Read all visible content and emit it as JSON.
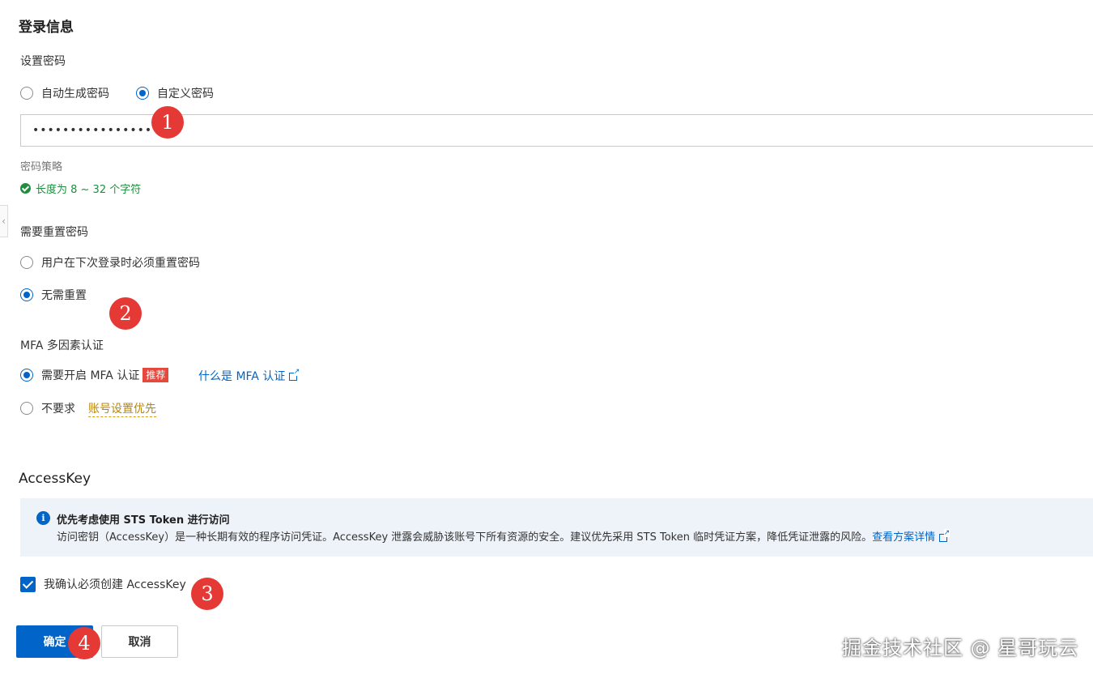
{
  "login_info": {
    "title": "登录信息",
    "set_password_label": "设置密码",
    "options": [
      {
        "label": "自动生成密码",
        "checked": false
      },
      {
        "label": "自定义密码",
        "checked": true
      }
    ],
    "password_value": "••••••••••••••••",
    "policy_label": "密码策略",
    "policy_rule": "长度为 8 ~ 32 个字符"
  },
  "reset_password": {
    "label": "需要重置密码",
    "options": [
      {
        "label": "用户在下次登录时必须重置密码",
        "checked": false
      },
      {
        "label": "无需重置",
        "checked": true
      }
    ]
  },
  "mfa": {
    "label": "MFA 多因素认证",
    "option_required": "需要开启 MFA 认证",
    "badge": "推荐",
    "help_link": "什么是 MFA 认证",
    "option_not_required": "不要求",
    "account_priority_link": "账号设置优先"
  },
  "accesskey": {
    "title": "AccessKey",
    "notice_title": "优先考虑使用 STS Token 进行访问",
    "notice_body": "访问密钥（AccessKey）是一种长期有效的程序访问凭证。AccessKey 泄露会威胁该账号下所有资源的安全。建议优先采用 STS Token 临时凭证方案，降低凭证泄露的风险。",
    "notice_link": "查看方案详情",
    "confirm_checkbox": "我确认必须创建 AccessKey"
  },
  "buttons": {
    "confirm": "确定",
    "cancel": "取消"
  },
  "markers": [
    "1",
    "2",
    "3",
    "4"
  ],
  "watermark": "掘金技术社区 @ 星哥玩云",
  "colors": {
    "primary": "#0064c8",
    "success": "#1e8e3e",
    "marker": "#e53935",
    "badge": "#e5483c"
  }
}
